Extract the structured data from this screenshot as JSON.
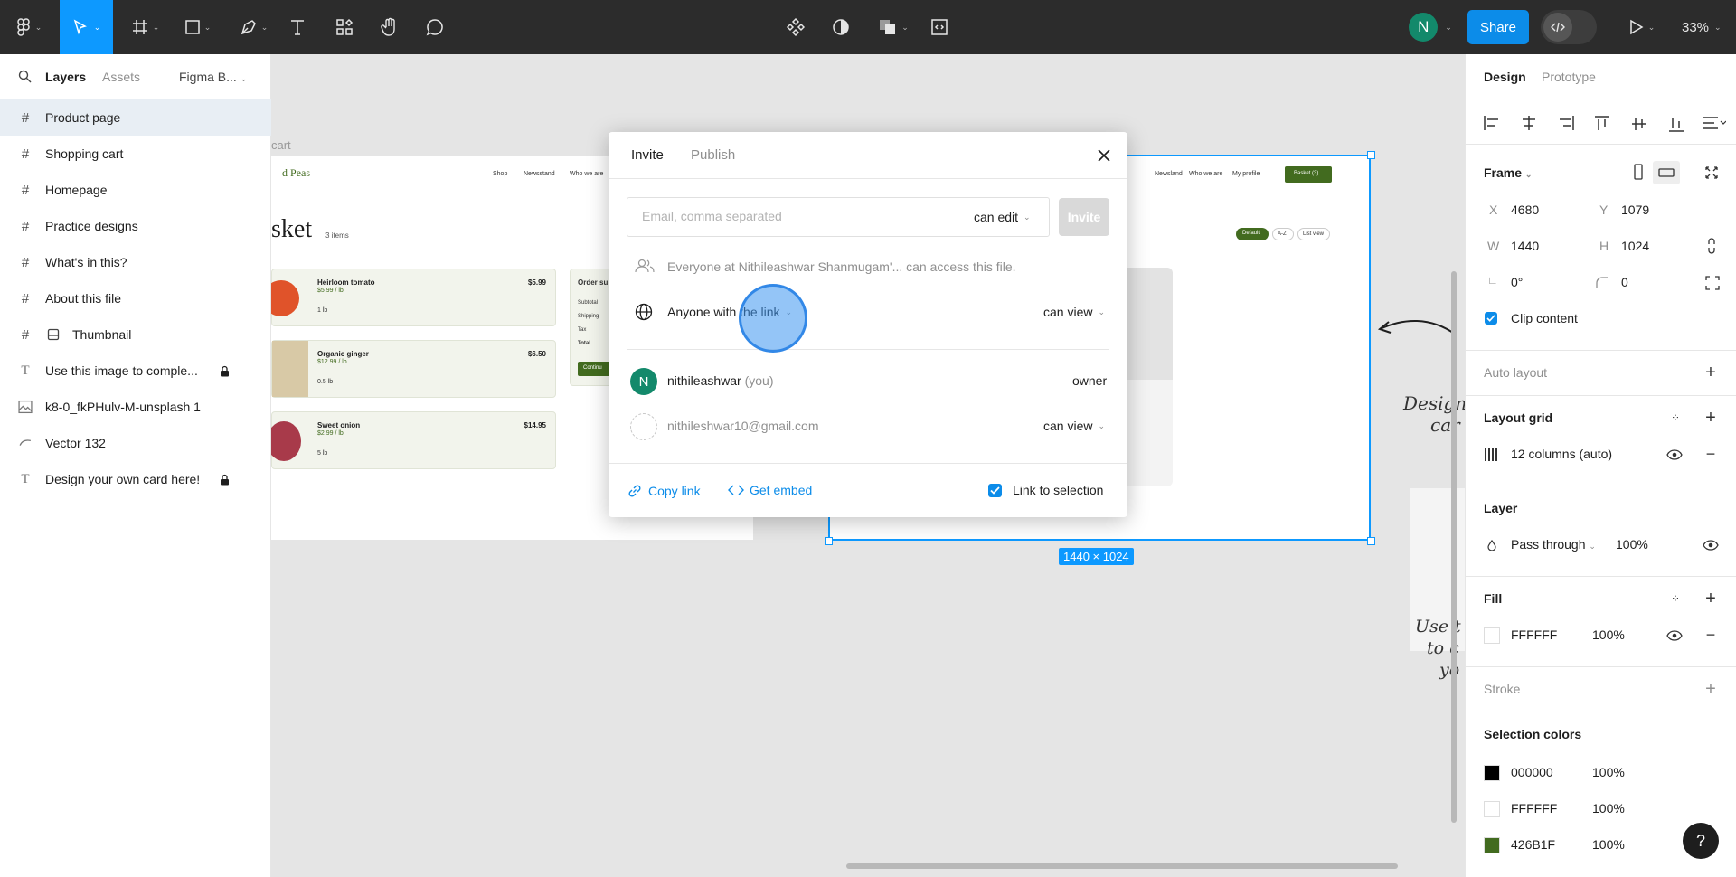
{
  "toolbar": {
    "zoom": "33%",
    "share_label": "Share",
    "avatar_initial": "N"
  },
  "left_panel": {
    "tabs": [
      "Layers",
      "Assets"
    ],
    "page_selector": "Figma B...",
    "layers": [
      {
        "label": "Product page",
        "icon": "frame-icon",
        "selected": true
      },
      {
        "label": "Shopping cart",
        "icon": "frame-icon"
      },
      {
        "label": "Homepage",
        "icon": "frame-icon"
      },
      {
        "label": "Practice designs",
        "icon": "frame-icon"
      },
      {
        "label": "What's in this?",
        "icon": "frame-icon"
      },
      {
        "label": "About this file",
        "icon": "frame-icon"
      },
      {
        "label": "Thumbnail",
        "icon": "component-icon"
      },
      {
        "label": "Use this image to comple...",
        "icon": "text-icon",
        "locked": true
      },
      {
        "label": "k8-0_fkPHulv-M-unsplash 1",
        "icon": "image-icon"
      },
      {
        "label": "Vector 132",
        "icon": "vector-icon"
      },
      {
        "label": "Design your own card here!",
        "icon": "text-icon",
        "locked": true
      }
    ]
  },
  "canvas": {
    "frame_label": "cart",
    "brand": "d Peas",
    "basket_title": "sket",
    "items_count": "3 items",
    "nav": [
      "Shop",
      "Newsstand",
      "Who we are"
    ],
    "nav_right": [
      "Newsland",
      "Who we are",
      "My profile"
    ],
    "basket_button": "Basket (3)",
    "filters": [
      "Default",
      "A-Z",
      "List view"
    ],
    "products": [
      {
        "name": "Heirloom tomato",
        "price": "$5.99 / lb",
        "qty": "1 lb",
        "total": "$5.99"
      },
      {
        "name": "Organic ginger",
        "price": "$12.99 / lb",
        "qty": "0.5 lb",
        "total": "$6.50"
      },
      {
        "name": "Sweet onion",
        "price": "$2.99 / lb",
        "qty": "5 lb",
        "total": "$14.95"
      }
    ],
    "order_summary": [
      "Order su",
      "Subtotal",
      "Shipping",
      "Tax",
      "Total",
      "Continu"
    ],
    "dimension_badge": "1440 × 1024",
    "handwriting_1": [
      "Design",
      "car"
    ],
    "handwriting_2": [
      "Use t",
      "to c",
      "yo"
    ]
  },
  "modal": {
    "tabs": [
      "Invite",
      "Publish"
    ],
    "email_placeholder": "Email, comma separated",
    "email_permission": "can edit",
    "invite_label": "Invite",
    "org_access_text": "Everyone at Nithileashwar Shanmugam'... can access this file.",
    "link_access_label": "Anyone with the link",
    "link_permission": "can view",
    "people": [
      {
        "initial": "N",
        "name": "nithileashwar",
        "suffix": "(you)",
        "role": "owner"
      },
      {
        "initial": "",
        "name": "nithileshwar10@gmail.com",
        "suffix": "",
        "role": "can view"
      }
    ],
    "copy_link": "Copy link",
    "get_embed": "Get embed",
    "link_to_selection": "Link to selection",
    "link_to_selection_checked": true
  },
  "right_panel": {
    "tabs": [
      "Design",
      "Prototype"
    ],
    "frame_label": "Frame",
    "x_label": "X",
    "x": "4680",
    "y_label": "Y",
    "y": "1079",
    "w_label": "W",
    "w": "1440",
    "h_label": "H",
    "h": "1024",
    "rotation": "0°",
    "radius": "0",
    "clip_content": "Clip content",
    "auto_layout": "Auto layout",
    "layout_grid": "Layout grid",
    "grid_value": "12 columns (auto)",
    "layer": "Layer",
    "blend_mode": "Pass through",
    "layer_opacity": "100%",
    "fill": "Fill",
    "fill_hex": "FFFFFF",
    "fill_opacity": "100%",
    "stroke": "Stroke",
    "selection_colors": "Selection colors",
    "colors": [
      {
        "hex": "000000",
        "opacity": "100%",
        "swatch": "#000000"
      },
      {
        "hex": "FFFFFF",
        "opacity": "100%",
        "swatch": "#FFFFFF"
      },
      {
        "hex": "426B1F",
        "opacity": "100%",
        "swatch": "#426B1F"
      }
    ],
    "help": "?"
  }
}
